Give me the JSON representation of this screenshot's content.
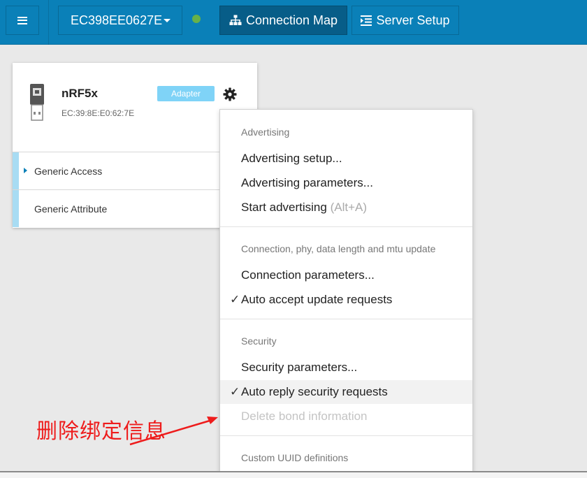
{
  "topbar": {
    "device_id": "EC398EE0627E",
    "status_color": "#67b14a",
    "tabs": [
      {
        "label": "Connection Map",
        "icon": "sitemap-icon",
        "active": true
      },
      {
        "label": "Server Setup",
        "icon": "indent-list-icon",
        "active": false
      }
    ]
  },
  "adapter": {
    "name": "nRF5x",
    "address": "EC:39:8E:E0:62:7E",
    "badge": "Adapter",
    "services": [
      {
        "label": "Generic Access",
        "expandable": true
      },
      {
        "label": "Generic Attribute",
        "expandable": false
      }
    ]
  },
  "menu": {
    "sections": [
      {
        "header": "Advertising",
        "items": [
          {
            "label": "Advertising setup..."
          },
          {
            "label": "Advertising parameters..."
          },
          {
            "label": "Start advertising",
            "hint": "(Alt+A)"
          }
        ]
      },
      {
        "header": "Connection, phy, data length and mtu update",
        "items": [
          {
            "label": "Connection parameters..."
          },
          {
            "label": "Auto accept update requests",
            "checked": true
          }
        ]
      },
      {
        "header": "Security",
        "items": [
          {
            "label": "Security parameters..."
          },
          {
            "label": "Auto reply security requests",
            "checked": true,
            "highlighted": true
          },
          {
            "label": "Delete bond information",
            "disabled": true
          }
        ]
      },
      {
        "header": "Custom UUID definitions",
        "items": []
      }
    ]
  },
  "annotation": {
    "text": "删除绑定信息",
    "color": "#ee1c1c"
  }
}
